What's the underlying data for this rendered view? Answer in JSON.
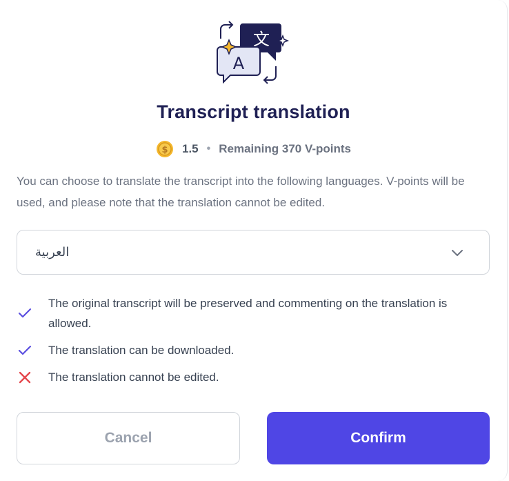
{
  "dialog": {
    "title": "Transcript translation",
    "illustration_icon": "translate-illustration-icon",
    "cost": {
      "coin_icon": "coin-icon",
      "value": "1.5",
      "separator": "•",
      "remaining": "Remaining 370 V-points"
    },
    "description": "You can choose to translate the transcript into the following languages. V-points will be used, and please note that the translation cannot be edited.",
    "language_select": {
      "selected": "العربية",
      "icon": "chevron-down-icon"
    },
    "features": [
      {
        "icon": "check-icon",
        "text": "The original transcript will be preserved and commenting on the translation is allowed."
      },
      {
        "icon": "check-icon",
        "text": "The translation can be downloaded."
      },
      {
        "icon": "cross-icon",
        "text": "The translation cannot be edited."
      }
    ],
    "buttons": {
      "cancel": "Cancel",
      "confirm": "Confirm"
    },
    "colors": {
      "title": "#1f2054",
      "accent": "#4f46e5",
      "check": "#5b4fe0",
      "cross": "#e5484d",
      "coin": "#f5b82e"
    }
  }
}
